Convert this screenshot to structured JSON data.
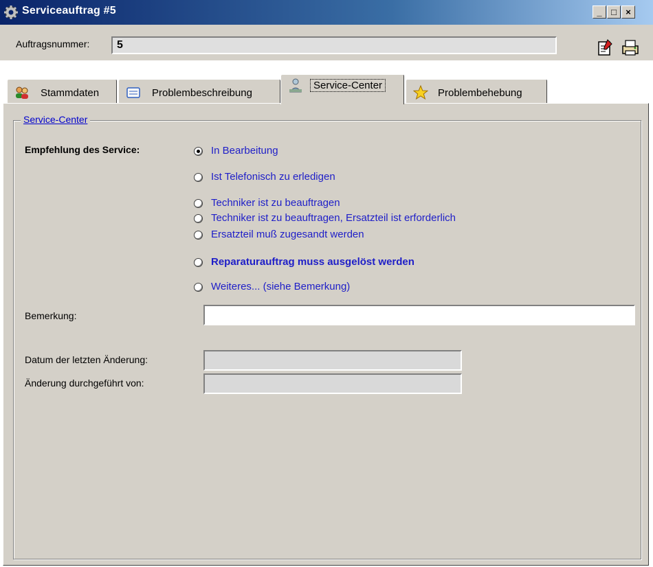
{
  "window": {
    "title": "Serviceauftrag #5",
    "controls": {
      "minimize": "_",
      "maximize": "□",
      "close": "×"
    }
  },
  "header": {
    "order_label": "Auftragsnummer:",
    "order_value": "5",
    "tools": [
      "edit-document-icon",
      "printer-icon"
    ]
  },
  "tabs": [
    {
      "label": "Stammdaten",
      "icon": "people-icon",
      "active": false
    },
    {
      "label": "Problembeschreibung",
      "icon": "document-icon",
      "active": false
    },
    {
      "label": "Service-Center",
      "icon": "service-person-icon",
      "active": true
    },
    {
      "label": "Problembehebung",
      "icon": "star-icon",
      "active": false
    }
  ],
  "service_center": {
    "group_title": "Service-Center",
    "recommendation_label": "Empfehlung des Service:",
    "options": [
      {
        "label": "In Bearbeitung",
        "checked": true,
        "bold": false
      },
      {
        "label": "Ist Telefonisch zu erledigen",
        "checked": false,
        "bold": false
      },
      {
        "label": "Techniker ist zu beauftragen",
        "checked": false,
        "bold": false
      },
      {
        "label": "Techniker ist zu beauftragen, Ersatzteil ist erforderlich",
        "checked": false,
        "bold": false
      },
      {
        "label": "Ersatzteil muß zugesandt werden",
        "checked": false,
        "bold": false
      },
      {
        "label": "Reparaturauftrag muss ausgelöst werden",
        "checked": false,
        "bold": true
      },
      {
        "label": "Weiteres... (siehe Bemerkung)",
        "checked": false,
        "bold": false
      }
    ],
    "remark_label": "Bemerkung:",
    "remark_value": "",
    "last_change_date_label": "Datum der letzten Änderung:",
    "last_change_date_value": "",
    "changed_by_label": "Änderung durchgeführt von:",
    "changed_by_value": ""
  },
  "colors": {
    "title_gradient_start": "#0a246a",
    "title_gradient_end": "#a6caf0",
    "face": "#d4d0c8",
    "radio_text": "#1e1ec8"
  }
}
